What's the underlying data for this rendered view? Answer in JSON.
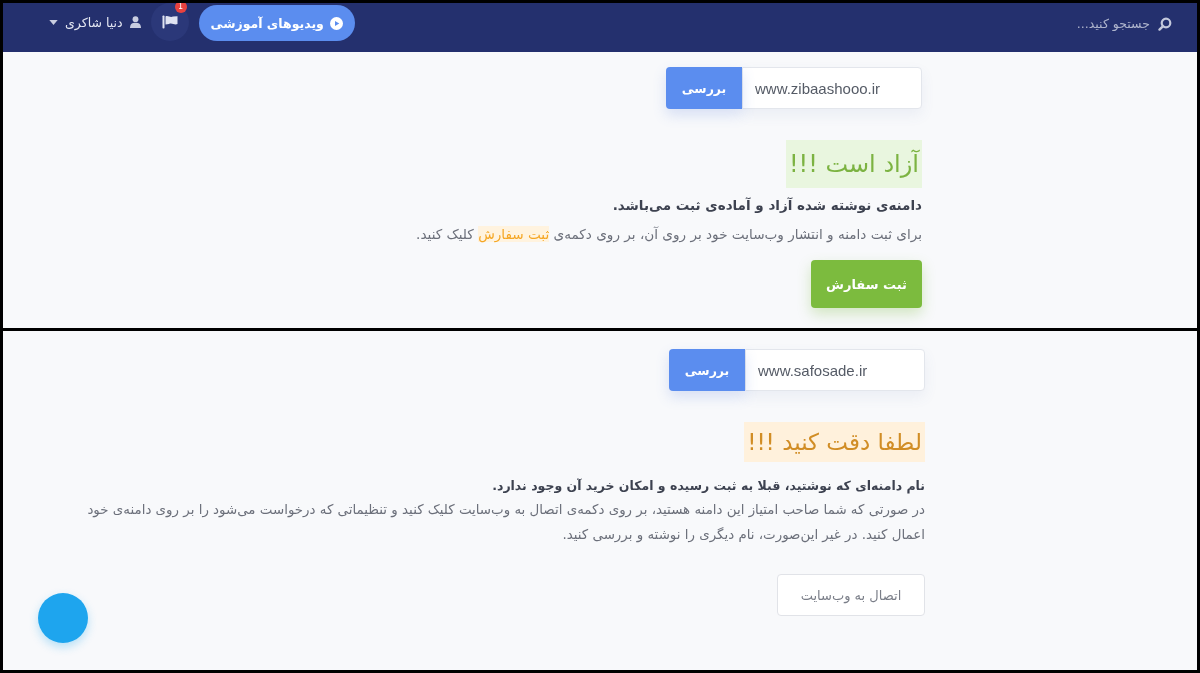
{
  "panels": [
    {
      "kind": "available",
      "header": {
        "search": {
          "placeholder": "جستجو کنید..."
        },
        "tutorial_button": {
          "label": "ویدیوهای آموزشی"
        },
        "notifications": {
          "badge": "1"
        },
        "user_menu": {
          "label": "دنیا شاکری"
        }
      },
      "domain_search": {
        "value": "www.zibaashooo.ir",
        "button": "بررسی"
      },
      "status_title": "آزاد است !!!",
      "message": "دامنه‌ی نوشته شده آزاد و آماده‌ی ثبت می‌باشد.",
      "paragraph": [
        {
          "text": "برای ثبت دامنه و انتشار وب‌سایت خود بر روی آن، بر روی دکمه‌ی ",
          "highlighted": false
        },
        {
          "text": "ثبت سفارش",
          "highlighted": true
        },
        {
          "text": " کلیک کنید.",
          "highlighted": false
        }
      ],
      "action_button": "ثبت سفارش"
    },
    {
      "kind": "taken",
      "domain_search": {
        "value": "www.safosade.ir",
        "button": "بررسی"
      },
      "status_title": "لطفا دقت کنید !!!",
      "message": "نام دامنه‌ای که نوشتید، قبلا به ثبت رسیده و امکان خرید آن وجود ندارد.",
      "paragraph": [
        {
          "text": "در صورتی که شما صاحب امتیاز این دامنه هستید، بر روی دکمه‌ی اتصال به وب‌سایت کلیک کنید و تنظیماتی که درخواست می‌شود را بر روی دامنه‌ی خود اعمال کنید. در غیر این‌صورت، نام دیگری را نوشته و بررسی کنید.",
          "highlighted": false
        }
      ],
      "action_button": "اتصال به وب‌سایت"
    }
  ]
}
